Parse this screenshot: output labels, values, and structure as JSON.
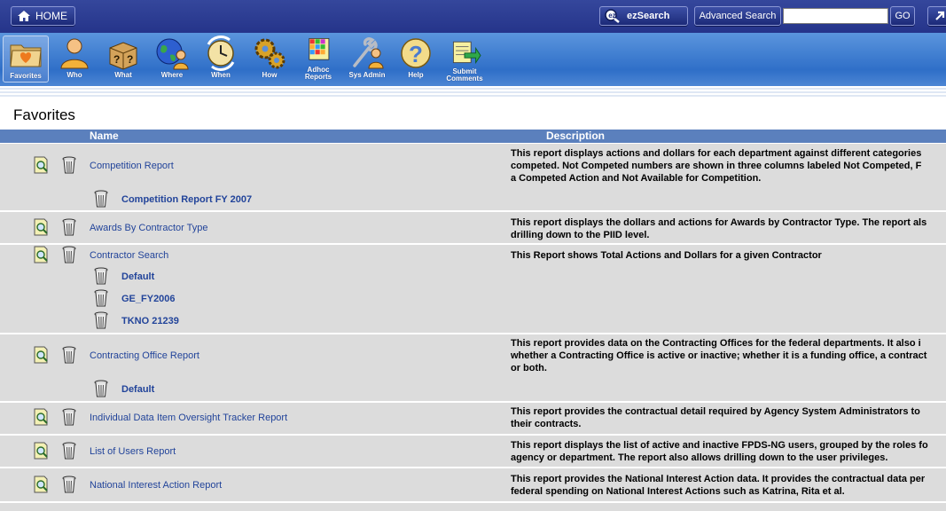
{
  "header": {
    "home_label": "HOME",
    "ezsearch_label": "ezSearch",
    "advanced_search_label": "Advanced Search",
    "search_value": "",
    "go_label": "GO"
  },
  "toolbar": {
    "items": [
      {
        "label": "Favorites",
        "icon": "folder-heart-icon"
      },
      {
        "label": "Who",
        "icon": "person-icon"
      },
      {
        "label": "What",
        "icon": "box-question-icon"
      },
      {
        "label": "Where",
        "icon": "globe-person-icon"
      },
      {
        "label": "When",
        "icon": "clock-icon"
      },
      {
        "label": "How",
        "icon": "gears-icon"
      },
      {
        "label": "Adhoc Reports",
        "icon": "grid-icon"
      },
      {
        "label": "Sys Admin",
        "icon": "tools-person-icon"
      },
      {
        "label": "Help",
        "icon": "help-icon"
      },
      {
        "label": "Submit Comments",
        "icon": "comment-arrow-icon"
      }
    ]
  },
  "page": {
    "title": "Favorites",
    "columns": {
      "name": "Name",
      "description": "Description"
    }
  },
  "reports": [
    {
      "name": "Competition Report",
      "description": [
        "This report displays actions and dollars for each department against different categories",
        "competed. Not Competed numbers are shown in three columns labeled Not Competed, F",
        "a Competed Action and Not Available for Competition."
      ],
      "saved": [
        "Competition Report FY 2007"
      ]
    },
    {
      "name": "Awards By Contractor Type",
      "description": [
        "This report displays the dollars and actions for Awards by Contractor Type. The report als",
        "drilling down to the PIID level."
      ],
      "saved": []
    },
    {
      "name": "Contractor Search",
      "description": [
        "This Report shows Total Actions and Dollars for a given Contractor"
      ],
      "saved": [
        "Default",
        "GE_FY2006",
        "TKNO 21239"
      ]
    },
    {
      "name": "Contracting Office Report",
      "description": [
        "This report provides data on the Contracting Offices for the federal departments. It also i",
        "whether a Contracting Office is active or inactive; whether it is a funding office, a contract",
        "or both."
      ],
      "saved": [
        "Default"
      ]
    },
    {
      "name": "Individual Data Item Oversight Tracker Report",
      "description": [
        "This report provides the contractual detail required by Agency System Administrators to",
        "their contracts."
      ],
      "saved": []
    },
    {
      "name": "List of Users Report",
      "description": [
        "This report displays the list of active and inactive FPDS-NG users, grouped by the roles fo",
        "agency or department. The report also allows drilling down to the user privileges."
      ],
      "saved": []
    },
    {
      "name": "National Interest Action Report",
      "description": [
        "This report provides the National Interest Action data. It provides the contractual data per",
        "federal spending on National Interest Actions such as Katrina, Rita et al."
      ],
      "saved": []
    }
  ]
}
